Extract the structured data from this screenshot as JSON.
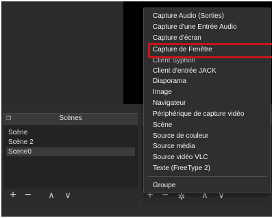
{
  "colors": {
    "window_bg": "#2d2d2d",
    "menu_bg": "#2f2f2f",
    "highlight_red": "#c8141b",
    "text": "#f0f0f0"
  },
  "scenes_dock": {
    "title": "Scènes",
    "float_icon": "dock-float-icon",
    "items": [
      "Scène",
      "Scène 2",
      "Scene0"
    ],
    "selected_index": 2,
    "toolbar": {
      "add": "+",
      "remove": "−",
      "up": "∧",
      "down": "∨"
    }
  },
  "sources_dock": {
    "float_icon": "dock-float-icon",
    "toolbar": {
      "add": "+",
      "remove": "−",
      "gear": "✲",
      "up": "∧",
      "down": "∨"
    }
  },
  "context_menu": {
    "items": [
      "Capture Audio (Sorties)",
      "Capture d'une Entrée Audio",
      "Capture d'écran",
      "Capture de Fenêtre",
      "Client Syphon",
      "Client d'entrée JACK",
      "Diaporama",
      "Image",
      "Navigateur",
      "Périphérique de capture vidéo",
      "Scène",
      "Source de couleur",
      "Source média",
      "Source vidéo VLC",
      "Texte (FreeType 2)"
    ],
    "group_item": "Groupe",
    "highlighted_item": "Capture de Fenêtre"
  }
}
